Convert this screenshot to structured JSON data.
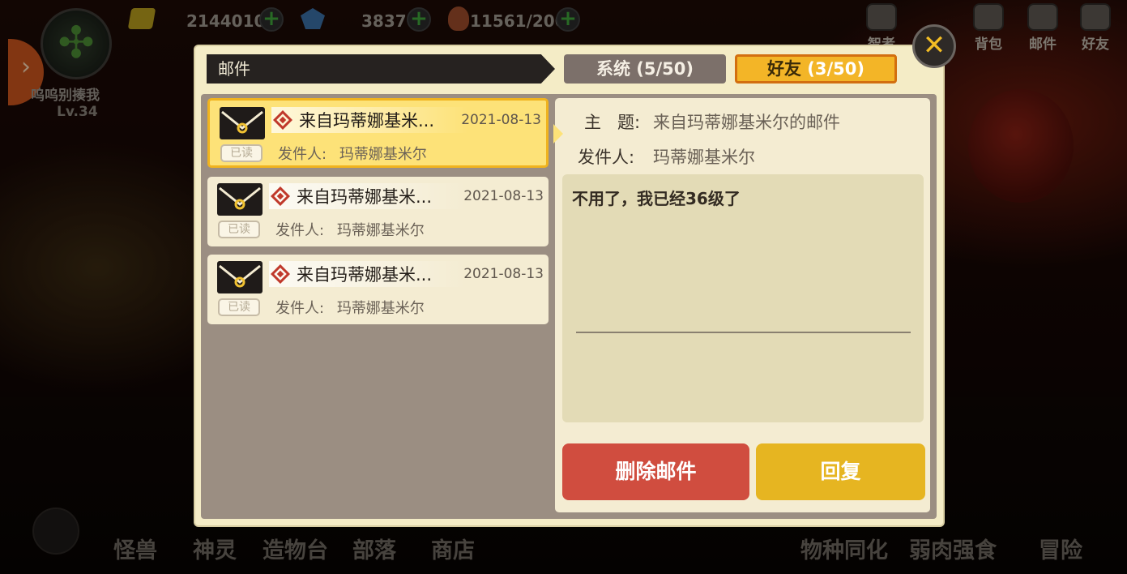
{
  "hud": {
    "gold": "2144010",
    "gems": "3837",
    "stamina": "11561/200",
    "plus": "+",
    "player_name": "呜呜别揍我",
    "level": "Lv.34",
    "top_icons": [
      "智者",
      "背包",
      "邮件",
      "好友"
    ]
  },
  "bottom_nav": [
    "怪兽",
    "神灵",
    "造物台",
    "部落",
    "商店",
    "物种同化",
    "弱肉强食",
    "冒险"
  ],
  "dialog": {
    "title": "邮件",
    "tab_system": "系统",
    "tab_system_count": "(5/50)",
    "tab_friends": "好友",
    "tab_friends_count": "(3/50)",
    "close": "✕"
  },
  "mails": [
    {
      "subject": "来自玛蒂娜基米...",
      "date": "2021-08-13",
      "sender_label": "发件人:",
      "sender": "玛蒂娜基米尔",
      "status": "已读"
    },
    {
      "subject": "来自玛蒂娜基米...",
      "date": "2021-08-13",
      "sender_label": "发件人:",
      "sender": "玛蒂娜基米尔",
      "status": "已读"
    },
    {
      "subject": "来自玛蒂娜基米...",
      "date": "2021-08-13",
      "sender_label": "发件人:",
      "sender": "玛蒂娜基米尔",
      "status": "已读"
    }
  ],
  "detail": {
    "subject_label": "主   题:",
    "subject": "来自玛蒂娜基米尔的邮件",
    "sender_label": "发件人:",
    "sender": "玛蒂娜基米尔",
    "body": "不用了，我已经36级了"
  },
  "actions": {
    "delete": "删除邮件",
    "reply": "回复"
  },
  "colors": {
    "selected_mail": "#fde278",
    "friends_tab": "#f3b527",
    "delete_button": "#d04d3f",
    "reply_button": "#e6b521"
  }
}
